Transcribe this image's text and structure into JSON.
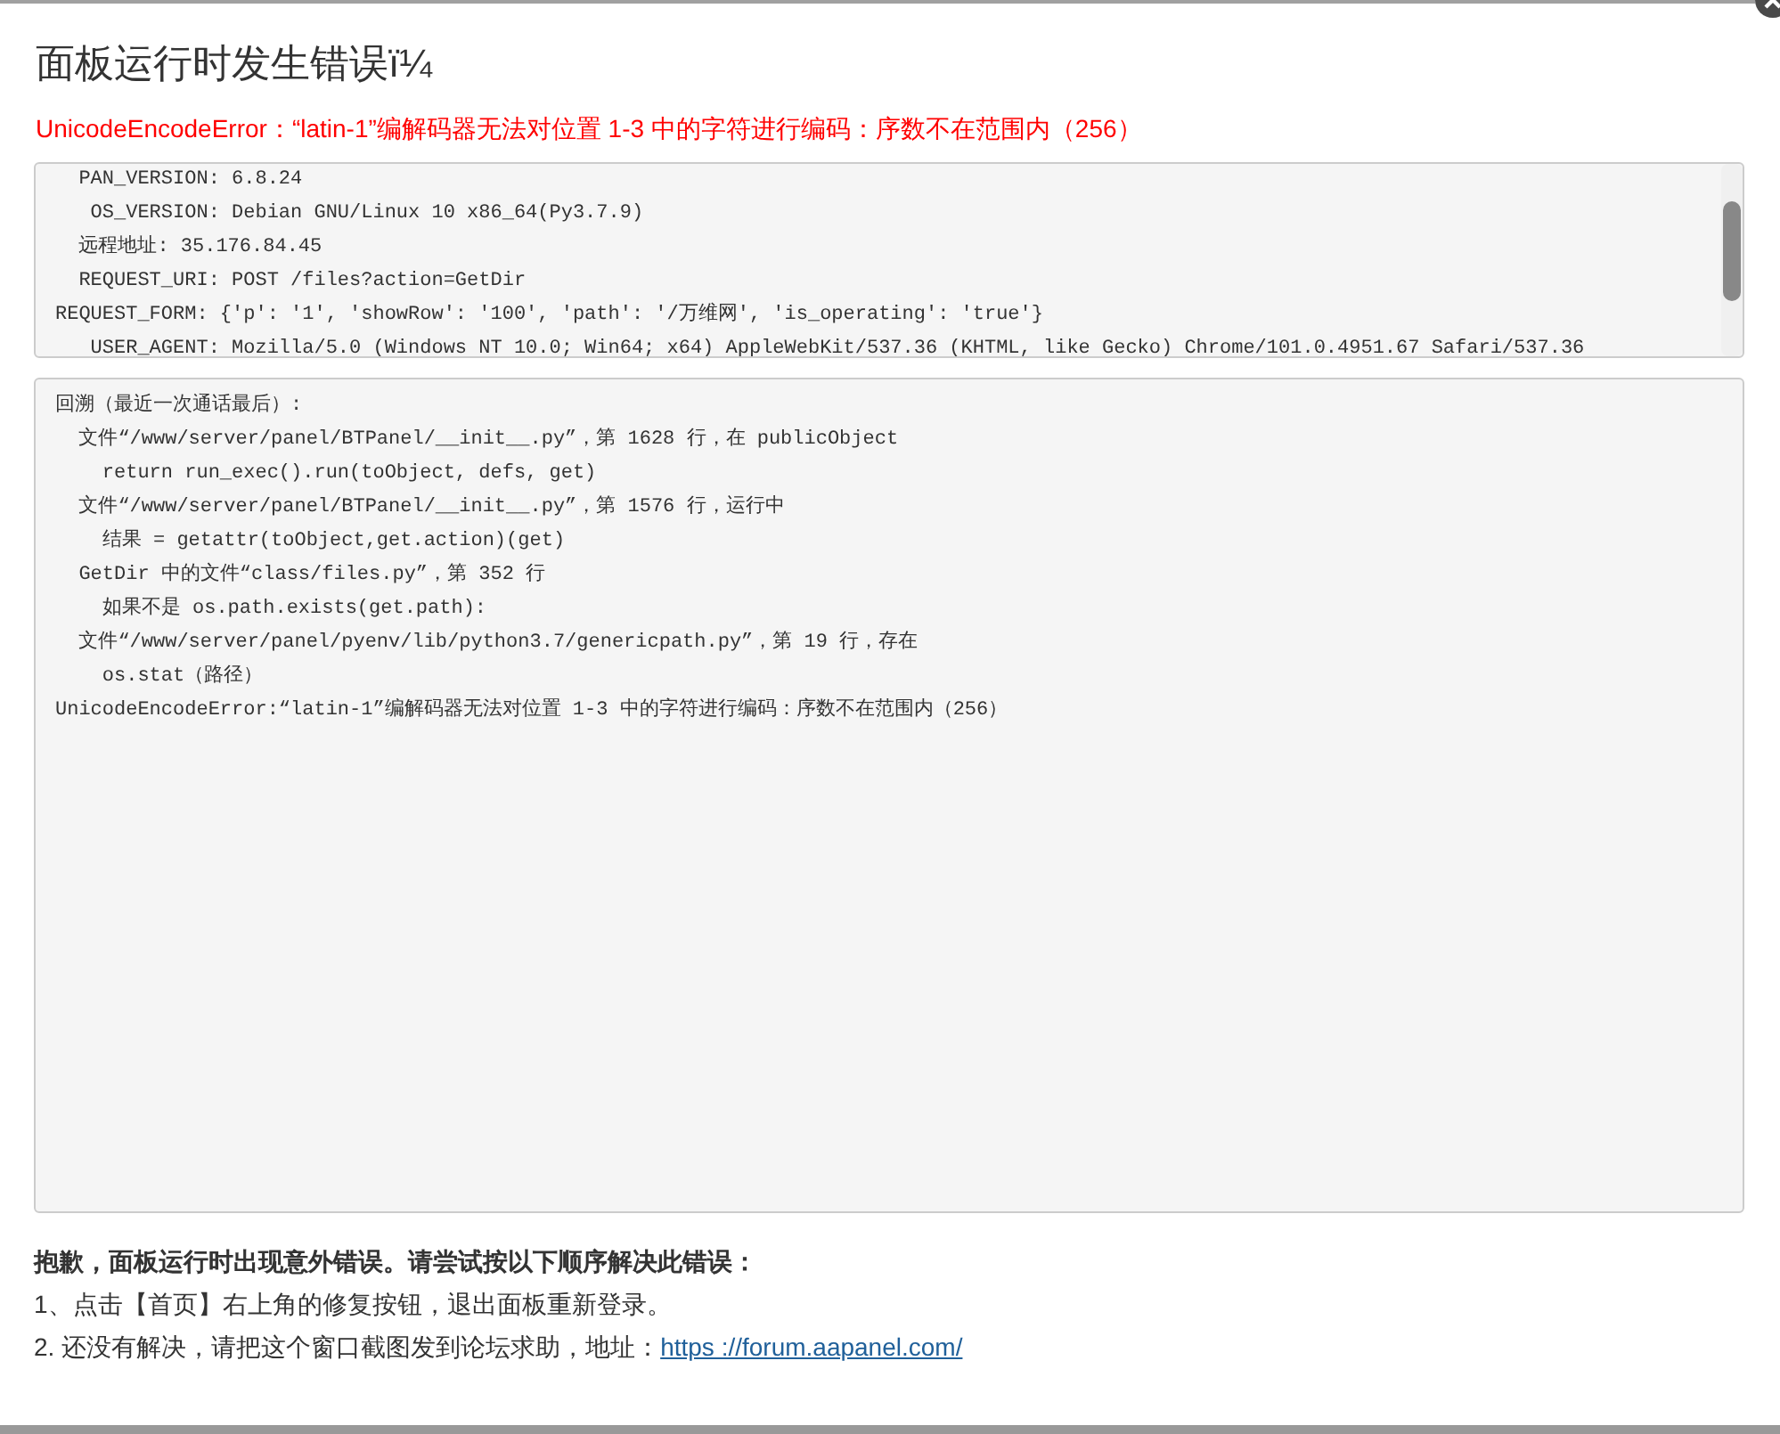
{
  "title": "面板运行时发生错误ï¼",
  "error_message": "UnicodeEncodeError：“latin-1”编解码器无法对位置 1-3 中的字符进行编码：序数不在范围内（256）",
  "environment_lines": [
    "  PAN_VERSION: 6.8.24",
    "   OS_VERSION: Debian GNU/Linux 10 x86_64(Py3.7.9)",
    "  远程地址: 35.176.84.45",
    "  REQUEST_URI: POST /files?action=GetDir",
    "REQUEST_FORM: {'p': '1', 'showRow': '100', 'path': '/万维网', 'is_operating': 'true'}",
    "   USER_AGENT: Mozilla/5.0 (Windows NT 10.0; Win64; x64) AppleWebKit/537.36 (KHTML, like Gecko) Chrome/101.0.4951.67 Safari/537.36"
  ],
  "traceback_lines": [
    "回溯（最近一次通话最后）:",
    "  文件“/www/server/panel/BTPanel/__init__.py”，第 1628 行，在 publicObject",
    "    return run_exec().run(toObject, defs, get)",
    "  文件“/www/server/panel/BTPanel/__init__.py”，第 1576 行，运行中",
    "    结果 = getattr(toObject,get.action)(get)",
    "  GetDir 中的文件“class/files.py”，第 352 行",
    "    如果不是 os.path.exists(get.path):",
    "  文件“/www/server/panel/pyenv/lib/python3.7/genericpath.py”，第 19 行，存在",
    "    os.stat（路径）",
    "UnicodeEncodeError:“latin-1”编解码器无法对位置 1-3 中的字符进行编码：序数不在范围内（256）"
  ],
  "help": {
    "heading": "抱歉，面板运行时出现意外错误。请尝试按以下顺序解决此错误：",
    "steps": [
      {
        "text": "1、点击【首页】右上角的修复按钮，退出面板重新登录。"
      },
      {
        "text": "2. 还没有解决，请把这个窗口截图发到论坛求助，地址：",
        "link": "https ://forum.aapanel.com/"
      }
    ]
  }
}
